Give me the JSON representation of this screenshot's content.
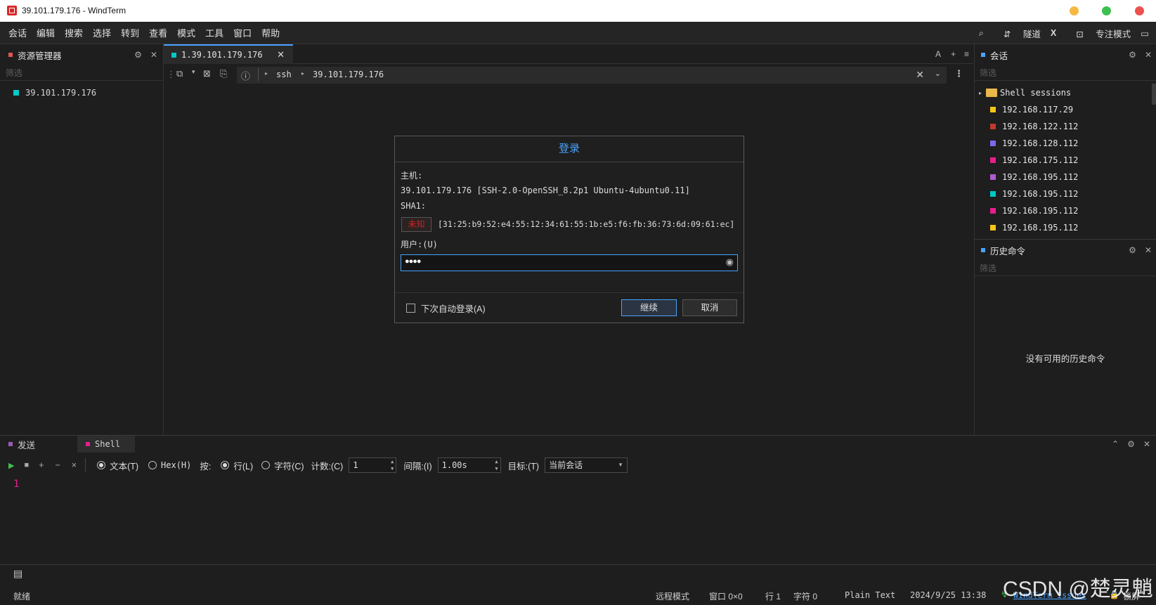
{
  "window": {
    "title": "39.101.179.176 - WindTerm"
  },
  "menu": {
    "items": [
      "会话",
      "编辑",
      "搜索",
      "选择",
      "转到",
      "查看",
      "模式",
      "工具",
      "窗口",
      "帮助"
    ]
  },
  "menu_right": {
    "tunnel": "隧道",
    "x": "X",
    "focus": "专注模式"
  },
  "explorer": {
    "title": "资源管理器",
    "filter_placeholder": "筛选",
    "item": "39.101.179.176"
  },
  "tab": {
    "label": "1.39.101.179.176"
  },
  "tab_right": {
    "a": "A",
    "plus": "+",
    "menu": "≡"
  },
  "address": {
    "protocol": "ssh",
    "host": "39.101.179.176"
  },
  "dialog": {
    "title": "登录",
    "host_label": "主机:",
    "host_value": "39.101.179.176 [SSH-2.0-OpenSSH_8.2p1 Ubuntu-4ubuntu0.11]",
    "sha_label": "SHA1:",
    "unknown_badge": "未知",
    "fingerprint": "[31:25:b9:52:e4:55:12:34:61:55:1b:e5:f6:fb:36:73:6d:09:61:ec]",
    "user_label": "用户:(U)",
    "user_value": "●●●●",
    "auto_login": "下次自动登录(A)",
    "continue": "继续",
    "cancel": "取消"
  },
  "sessions": {
    "title": "会话",
    "filter_placeholder": "筛选",
    "folder": "Shell sessions",
    "items": [
      {
        "label": "192.168.117.29",
        "color": "#f5c518"
      },
      {
        "label": "192.168.122.112",
        "color": "#c0392b"
      },
      {
        "label": "192.168.128.112",
        "color": "#7b68ee"
      },
      {
        "label": "192.168.175.112",
        "color": "#e91e8c"
      },
      {
        "label": "192.168.195.112",
        "color": "#b05cd6"
      },
      {
        "label": "192.168.195.112",
        "color": "#00c8c8"
      },
      {
        "label": "192.168.195.112",
        "color": "#e91e8c"
      },
      {
        "label": "192.168.195.112",
        "color": "#f5c518"
      }
    ]
  },
  "history": {
    "title": "历史命令",
    "filter_placeholder": "筛选",
    "empty": "没有可用的历史命令"
  },
  "send": {
    "tab_send": "发送",
    "tab_shell": "Shell",
    "text_opt": "文本(T)",
    "hex_opt": "Hex(H)",
    "by": "按:",
    "line_opt": "行(L)",
    "char_opt": "字符(C)",
    "count_label": "计数:(C)",
    "count_value": "1",
    "interval_label": "间隔:(I)",
    "interval_value": "1.00s",
    "target_label": "目标:(T)",
    "target_value": "当前会话",
    "line_number": "1"
  },
  "status": {
    "ready": "就绪",
    "remote_mode": "远程模式",
    "window": "窗口 0×0",
    "line": "行 1",
    "char": "字符 0",
    "syntax": "Plain Text",
    "datetime": "2024/9/25 13:38",
    "issues": "WindTerm Issues",
    "lock": "锁屏"
  },
  "watermark": "CSDN @楚灵魈",
  "colors": {
    "accent": "#4aa3ff",
    "explorer_sq": "#e25555",
    "host_sq": "#00c8c8",
    "send_sq": "#9b59b6",
    "shell_sq": "#e91e8c",
    "unknown_red": "#d02020"
  }
}
